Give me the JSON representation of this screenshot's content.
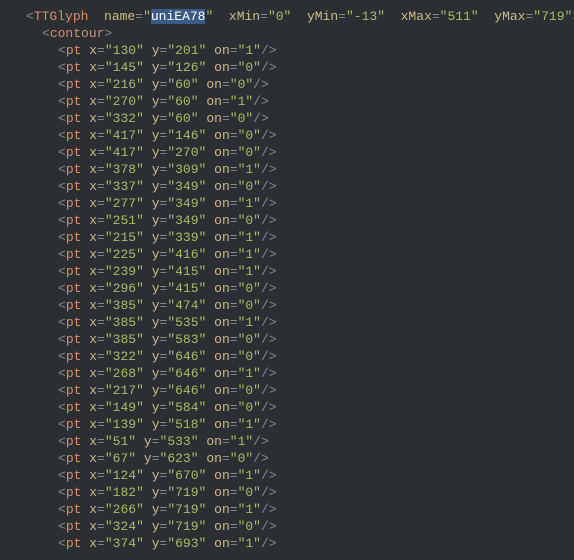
{
  "header": {
    "tag": "TTGlyph",
    "attrs": {
      "name": "uniEA78",
      "xMin": "0",
      "yMin": "-13",
      "xMax": "511",
      "yMax": "719"
    },
    "selectedAttr": "name"
  },
  "contourTag": "contour",
  "ptTag": "pt",
  "points": [
    {
      "x": "130",
      "y": "201",
      "on": "1"
    },
    {
      "x": "145",
      "y": "126",
      "on": "0"
    },
    {
      "x": "216",
      "y": "60",
      "on": "0"
    },
    {
      "x": "270",
      "y": "60",
      "on": "1"
    },
    {
      "x": "332",
      "y": "60",
      "on": "0"
    },
    {
      "x": "417",
      "y": "146",
      "on": "0"
    },
    {
      "x": "417",
      "y": "270",
      "on": "0"
    },
    {
      "x": "378",
      "y": "309",
      "on": "1"
    },
    {
      "x": "337",
      "y": "349",
      "on": "0"
    },
    {
      "x": "277",
      "y": "349",
      "on": "1"
    },
    {
      "x": "251",
      "y": "349",
      "on": "0"
    },
    {
      "x": "215",
      "y": "339",
      "on": "1"
    },
    {
      "x": "225",
      "y": "416",
      "on": "1"
    },
    {
      "x": "239",
      "y": "415",
      "on": "1"
    },
    {
      "x": "296",
      "y": "415",
      "on": "0"
    },
    {
      "x": "385",
      "y": "474",
      "on": "0"
    },
    {
      "x": "385",
      "y": "535",
      "on": "1"
    },
    {
      "x": "385",
      "y": "583",
      "on": "0"
    },
    {
      "x": "322",
      "y": "646",
      "on": "0"
    },
    {
      "x": "268",
      "y": "646",
      "on": "1"
    },
    {
      "x": "217",
      "y": "646",
      "on": "0"
    },
    {
      "x": "149",
      "y": "584",
      "on": "0"
    },
    {
      "x": "139",
      "y": "518",
      "on": "1"
    },
    {
      "x": "51",
      "y": "533",
      "on": "1"
    },
    {
      "x": "67",
      "y": "623",
      "on": "0"
    },
    {
      "x": "124",
      "y": "670",
      "on": "1"
    },
    {
      "x": "182",
      "y": "719",
      "on": "0"
    },
    {
      "x": "266",
      "y": "719",
      "on": "1"
    },
    {
      "x": "324",
      "y": "719",
      "on": "0"
    },
    {
      "x": "374",
      "y": "693",
      "on": "1"
    }
  ]
}
